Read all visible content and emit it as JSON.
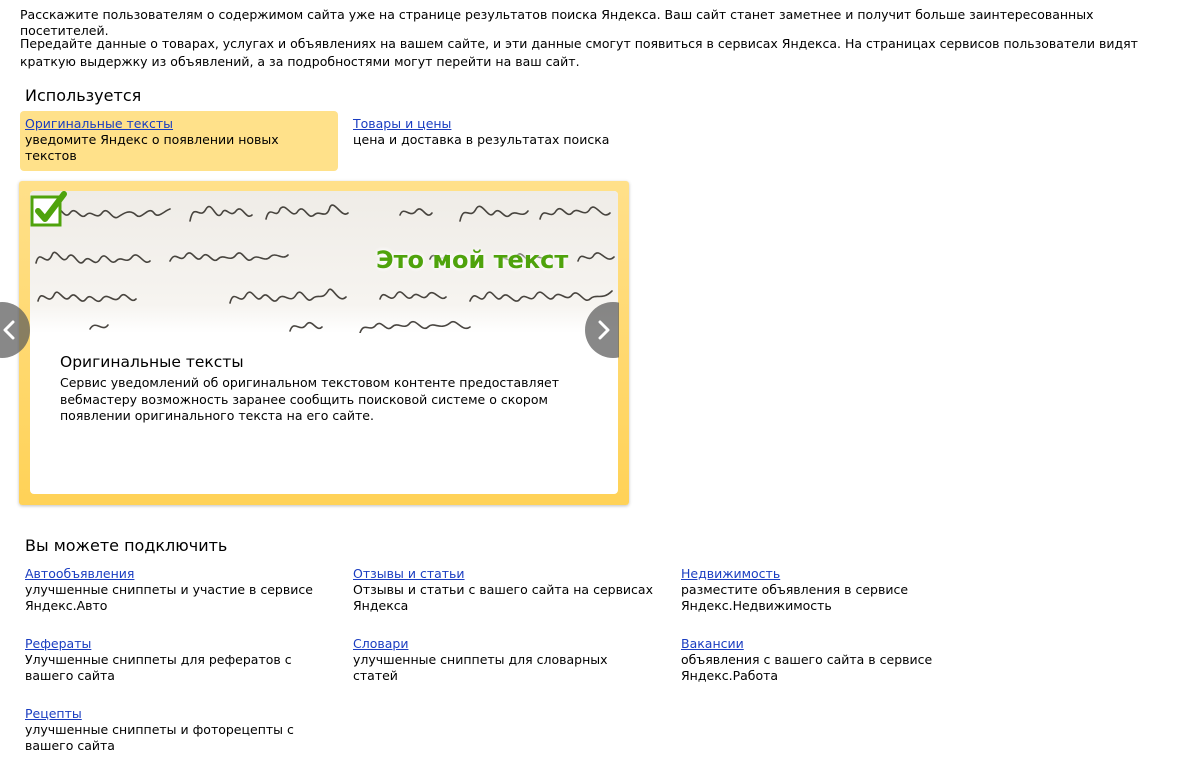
{
  "intro": {
    "line1": "Расскажите пользователям о содержимом сайта уже на странице результатов поиска Яндекса. Ваш сайт станет заметнее и получит больше заинтересованных посетителей.",
    "line2": "Передайте данные о товарах, услугах и объявлениях на вашем сайте, и эти данные смогут появиться в сервисах Яндекса. На страницах сервисов пользователи видят краткую выдержку из объявлений, а за подробностями могут перейти на ваш сайт."
  },
  "used": {
    "title": "Используется",
    "items": [
      {
        "label": "Оригинальные тексты",
        "desc": "уведомите Яндекс о появлении новых текстов"
      },
      {
        "label": "Товары и цены",
        "desc": "цена и доставка в результатах поиска"
      }
    ]
  },
  "slide": {
    "banner_text": "Это мой текст",
    "title": "Оригинальные тексты",
    "desc": "Сервис уведомлений об оригинальном текстовом контенте предоставляет вебмастеру возможность заранее сообщить поисковой системе о скором появлении оригинального текста на его сайте."
  },
  "available": {
    "title": "Вы можете подключить",
    "items": [
      {
        "label": "Автообъявления",
        "desc": "улучшенные сниппеты и участие в сервисе Яндекс.Авто"
      },
      {
        "label": "Отзывы и статьи",
        "desc": "Отзывы и статьи с вашего сайта на сервисах Яндекса"
      },
      {
        "label": "Недвижимость",
        "desc": "разместите объявления в сервисе Яндекс.Недвижимость"
      },
      {
        "label": "Рефераты",
        "desc": "Улучшенные сниппеты для рефератов с вашего сайта"
      },
      {
        "label": "Словари",
        "desc": "улучшенные сниппеты для словарных статей"
      },
      {
        "label": "Вакансии",
        "desc": "объявления с вашего сайта в сервисе Яндекс.Работа"
      },
      {
        "label": "Рецепты",
        "desc": "улучшенные сниппеты и фоторецепты с вашего сайта"
      }
    ]
  },
  "colors": {
    "link": "#1a3dc1",
    "active_tab": "#ffe18a",
    "frame": "#ffd257",
    "banner_text": "#4fa30c"
  },
  "icons": {
    "prev": "chevron-left-icon",
    "next": "chevron-right-icon",
    "check": "checkmark-icon"
  }
}
